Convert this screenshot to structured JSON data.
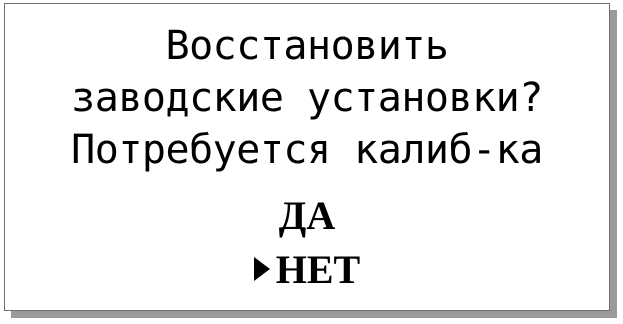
{
  "dialog": {
    "line1": "Восстановить",
    "line2": "заводские установки?",
    "line3": "Потребуется калиб-ка"
  },
  "options": [
    {
      "label": "ДА",
      "selected": false
    },
    {
      "label": "НЕТ",
      "selected": true
    }
  ],
  "cursor_icon": "triangle-right-icon"
}
